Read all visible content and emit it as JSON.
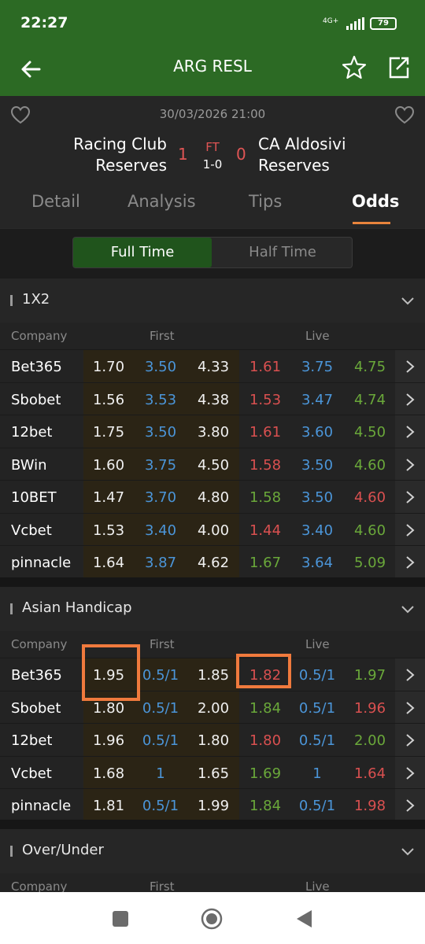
{
  "status": {
    "time": "22:27",
    "network": "4G+",
    "battery": "79"
  },
  "app_bar": {
    "title": "ARG RESL"
  },
  "match": {
    "date": "30/03/2026 21:00",
    "home_line1": "Racing Club",
    "home_line2": "Reserves",
    "away_line1": "CA Aldosivi",
    "away_line2": "Reserves",
    "home_score": "1",
    "away_score": "0",
    "status": "FT",
    "halftime": "1-0"
  },
  "tabs": [
    "Detail",
    "Analysis",
    "Tips",
    "Odds"
  ],
  "toggle": {
    "full": "Full Time",
    "half": "Half Time"
  },
  "columns": {
    "company": "Company",
    "first": "First",
    "live": "Live"
  },
  "sections": {
    "x12": {
      "title": "1X2",
      "rows": [
        {
          "company": "Bet365",
          "f": [
            "1.70",
            "3.50",
            "4.33"
          ],
          "l": [
            "1.61",
            "3.75",
            "4.75"
          ],
          "lc": [
            "red",
            "blue",
            "green"
          ]
        },
        {
          "company": "Sbobet",
          "f": [
            "1.56",
            "3.53",
            "4.38"
          ],
          "l": [
            "1.53",
            "3.47",
            "4.74"
          ],
          "lc": [
            "red",
            "blue",
            "green"
          ]
        },
        {
          "company": "12bet",
          "f": [
            "1.75",
            "3.50",
            "3.80"
          ],
          "l": [
            "1.61",
            "3.60",
            "4.50"
          ],
          "lc": [
            "red",
            "blue",
            "green"
          ]
        },
        {
          "company": "BWin",
          "f": [
            "1.60",
            "3.75",
            "4.50"
          ],
          "l": [
            "1.58",
            "3.50",
            "4.60"
          ],
          "lc": [
            "red",
            "blue",
            "green"
          ]
        },
        {
          "company": "10BET",
          "f": [
            "1.47",
            "3.70",
            "4.80"
          ],
          "l": [
            "1.58",
            "3.50",
            "4.60"
          ],
          "lc": [
            "green",
            "blue",
            "red"
          ]
        },
        {
          "company": "Vcbet",
          "f": [
            "1.53",
            "3.40",
            "4.00"
          ],
          "l": [
            "1.44",
            "3.40",
            "4.60"
          ],
          "lc": [
            "red",
            "blue",
            "green"
          ]
        },
        {
          "company": "pinnacle",
          "f": [
            "1.64",
            "3.87",
            "4.62"
          ],
          "l": [
            "1.67",
            "3.64",
            "5.09"
          ],
          "lc": [
            "green",
            "blue",
            "green"
          ]
        }
      ]
    },
    "ah": {
      "title": "Asian Handicap",
      "rows": [
        {
          "company": "Bet365",
          "f": [
            "1.95",
            "0.5/1",
            "1.85"
          ],
          "l": [
            "1.82",
            "0.5/1",
            "1.97"
          ],
          "lc": [
            "red",
            "blue",
            "green"
          ]
        },
        {
          "company": "Sbobet",
          "f": [
            "1.80",
            "0.5/1",
            "2.00"
          ],
          "l": [
            "1.84",
            "0.5/1",
            "1.96"
          ],
          "lc": [
            "green",
            "blue",
            "red"
          ]
        },
        {
          "company": "12bet",
          "f": [
            "1.96",
            "0.5/1",
            "1.80"
          ],
          "l": [
            "1.80",
            "0.5/1",
            "2.00"
          ],
          "lc": [
            "red",
            "blue",
            "green"
          ]
        },
        {
          "company": "Vcbet",
          "f": [
            "1.68",
            "1",
            "1.65"
          ],
          "l": [
            "1.69",
            "1",
            "1.64"
          ],
          "lc": [
            "green",
            "blue",
            "red"
          ]
        },
        {
          "company": "pinnacle",
          "f": [
            "1.81",
            "0.5/1",
            "1.99"
          ],
          "l": [
            "1.84",
            "0.5/1",
            "1.98"
          ],
          "lc": [
            "green",
            "blue",
            "red"
          ]
        }
      ]
    },
    "ou": {
      "title": "Over/Under"
    }
  },
  "colors": {
    "header_green": "#2c6a24",
    "highlight": "#f07a3d",
    "tab_accent": "#e8843c"
  }
}
